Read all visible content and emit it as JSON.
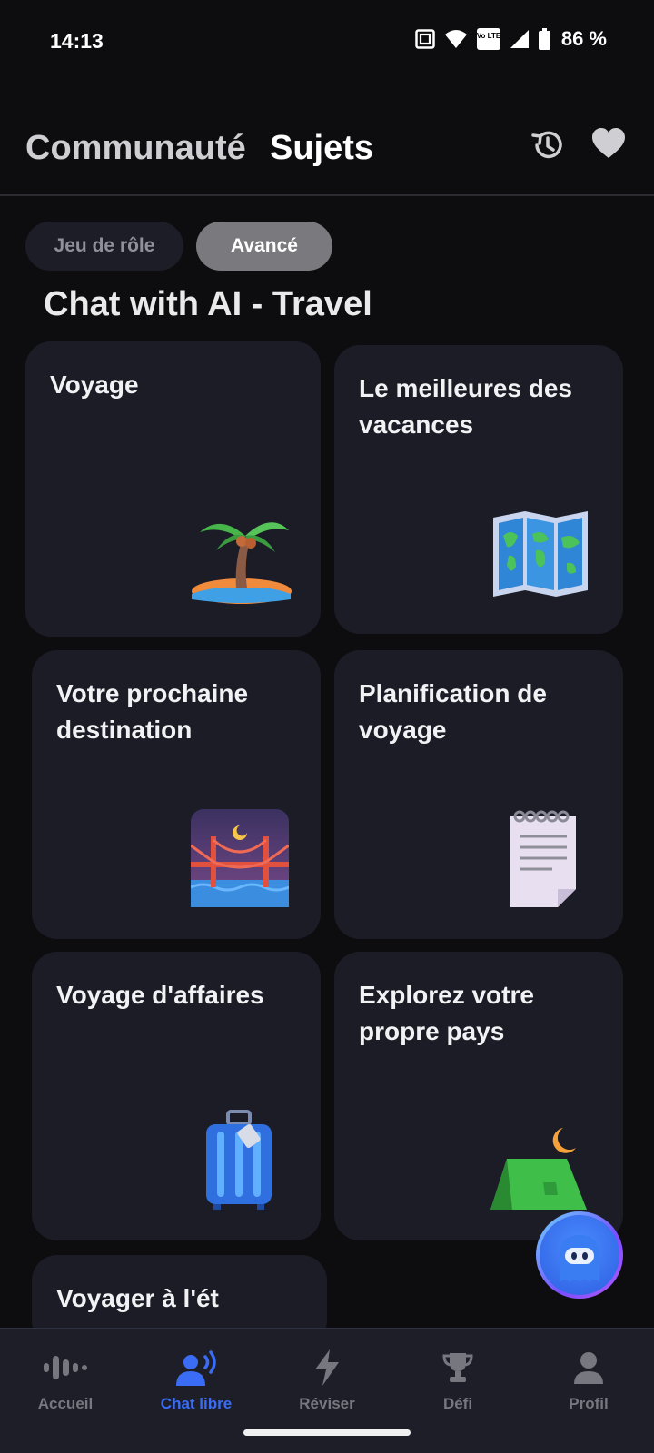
{
  "status_bar": {
    "time": "14:13",
    "battery_percent": "86 %",
    "volte_label": "Vo LTE"
  },
  "header": {
    "tab_community": "Communauté",
    "tab_topics": "Sujets",
    "history_icon": "history-icon",
    "favorites_icon": "heart-icon"
  },
  "chips": {
    "roleplay": "Jeu de rôle",
    "advanced": "Avancé"
  },
  "section": {
    "title": "Chat with AI - Travel"
  },
  "cards": [
    {
      "title": "Voyage",
      "icon": "palm-island-icon"
    },
    {
      "title": "Le meilleures des vacances",
      "icon": "world-map-icon"
    },
    {
      "title": "Votre prochaine destination",
      "icon": "bridge-night-icon"
    },
    {
      "title": "Planification de voyage",
      "icon": "notepad-icon"
    },
    {
      "title": "Voyage d'affaires",
      "icon": "luggage-icon"
    },
    {
      "title": "Explorez votre propre pays",
      "icon": "tent-icon"
    },
    {
      "title": "Voyager à l'ét",
      "icon": ""
    }
  ],
  "bottom_nav": {
    "items": [
      {
        "label": "Accueil",
        "icon": "waveform-icon"
      },
      {
        "label": "Chat libre",
        "icon": "voice-chat-icon"
      },
      {
        "label": "Réviser",
        "icon": "lightning-icon"
      },
      {
        "label": "Défi",
        "icon": "trophy-icon"
      },
      {
        "label": "Profil",
        "icon": "profile-icon"
      }
    ],
    "active_index": 1
  },
  "colors": {
    "background": "#0d0d0f",
    "card": "#1b1c26",
    "accent": "#3b6cf5",
    "chip_active": "#7a7a7e"
  }
}
